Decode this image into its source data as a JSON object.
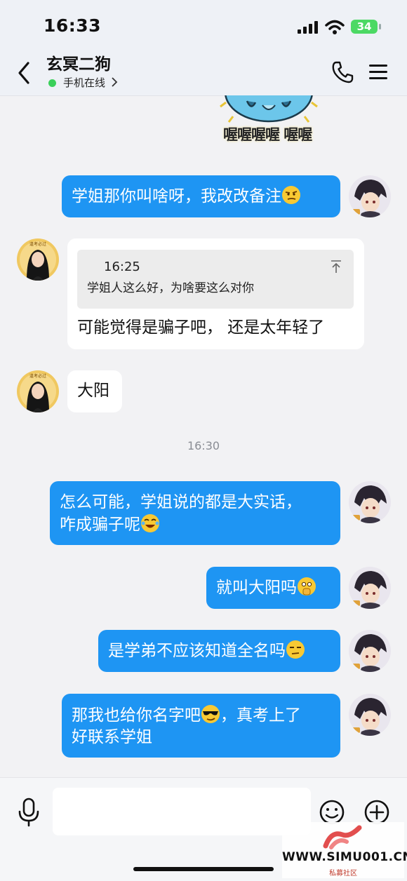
{
  "status_bar": {
    "time": "16:33",
    "battery": "34"
  },
  "header": {
    "contact_name": "玄冥二狗",
    "online_status": "手机在线"
  },
  "sticker": {
    "caption": "喔喔喔喔 喔喔"
  },
  "messages": [
    {
      "side": "out",
      "text": "学姐那你叫啥呀，我改改备注",
      "emoji": "smirk-emoji"
    },
    {
      "side": "in",
      "quote": {
        "time": "16:25",
        "text": "学姐人这么好，为啥要这么对你"
      },
      "text": "可能觉得是骗子吧， 还是太年轻了"
    },
    {
      "side": "in",
      "text": "大阳"
    },
    {
      "side": "out",
      "text_line1": "怎么可能，学姐说的都是大实话，",
      "text_line2": "咋成骗子呢",
      "emoji": "laugh-cry-emoji"
    },
    {
      "side": "out",
      "text": "就叫大阳吗",
      "emoji": "shush-emoji"
    },
    {
      "side": "out",
      "text": "是学弟不应该知道全名吗",
      "emoji": "unamused-emoji"
    },
    {
      "side": "out",
      "text_line1a": "那我也给你名字吧",
      "text_line1b": "，真考上了",
      "text_line2": "好联系学姐",
      "emoji": "sunglasses-emoji"
    }
  ],
  "time_divider": "16:30",
  "watermark": {
    "text": "WWW.SIMU001.CN",
    "sub": "私募社区"
  },
  "colors": {
    "bubble_out": "#1e95f3",
    "bubble_in": "#ffffff",
    "background": "#f2f2f4",
    "online": "#3ad05a"
  }
}
